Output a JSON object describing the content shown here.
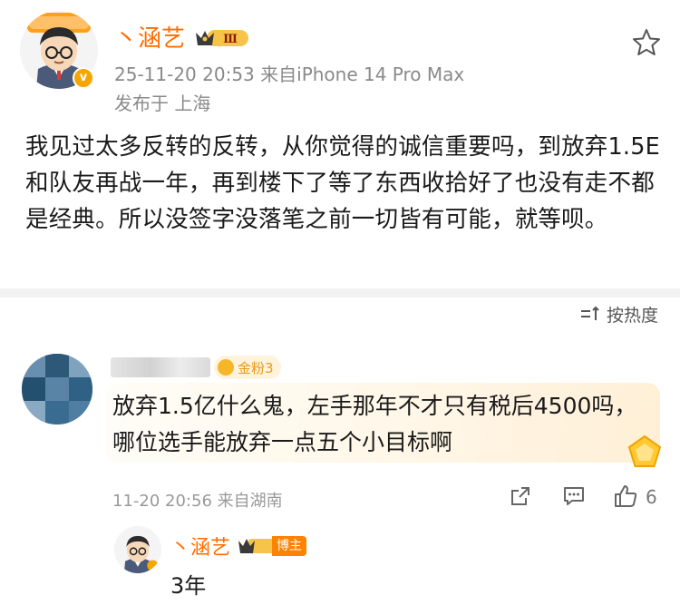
{
  "post": {
    "author": "丶涵艺",
    "level": "Ⅲ",
    "verified_mark": "v",
    "time_source": "25-11-20 20:53  来自iPhone 14 Pro Max",
    "location": "发布于 上海",
    "text": "我见过太多反转的反转，从你觉得的诚信重要吗，到放弃1.5E和队友再战一年，再到楼下了等了东西收拾好了也没有走不都是经典。所以没签字没落笔之前一切皆有可能，就等呗。",
    "icons": {
      "favorite": "star-outline-icon",
      "avatar": "cartoon-avatar"
    }
  },
  "comments": {
    "sort_label": "按热度",
    "items": [
      {
        "fan_badge": "金粉3",
        "text": "放弃1.5亿什么鬼，左手那年不才只有税后4500吗，哪位选手能放弃一点五个小目标啊",
        "time_source": "11-20 20:56  来自湖南",
        "like_count": "6",
        "reply": {
          "author": "丶涵艺",
          "host_label": "博主",
          "text": "3年"
        }
      }
    ]
  },
  "colors": {
    "accent": "#ff6d00",
    "meta": "#8a8a8a",
    "bubble": "#fff6e6"
  }
}
